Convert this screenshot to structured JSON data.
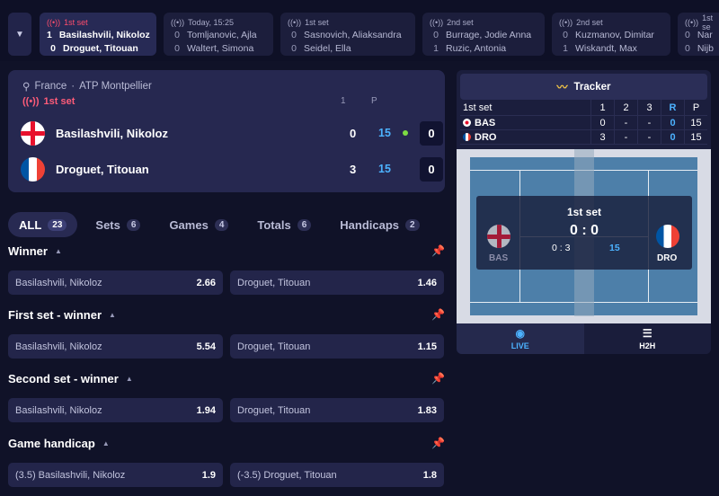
{
  "strip": {
    "matches": [
      {
        "status": "1st set",
        "active": true,
        "p1": {
          "score": "1",
          "name": "Basilashvili, Nikoloz"
        },
        "p2": {
          "score": "0",
          "name": "Droguet, Titouan"
        }
      },
      {
        "status": "Today, 15:25",
        "active": false,
        "p1": {
          "score": "0",
          "name": "Tomljanovic, Ajla"
        },
        "p2": {
          "score": "0",
          "name": "Waltert, Simona"
        }
      },
      {
        "status": "1st set",
        "active": false,
        "p1": {
          "score": "0",
          "name": "Sasnovich, Aliaksandra"
        },
        "p2": {
          "score": "0",
          "name": "Seidel, Ella"
        }
      },
      {
        "status": "2nd set",
        "active": false,
        "p1": {
          "score": "0",
          "name": "Burrage, Jodie Anna"
        },
        "p2": {
          "score": "1",
          "name": "Ruzic, Antonia"
        }
      },
      {
        "status": "2nd set",
        "active": false,
        "p1": {
          "score": "0",
          "name": "Kuzmanov, Dimitar"
        },
        "p2": {
          "score": "1",
          "name": "Wiskandt, Max"
        }
      },
      {
        "status": "1st se",
        "active": false,
        "p1": {
          "score": "0",
          "name": "Nar"
        },
        "p2": {
          "score": "0",
          "name": "Nijb"
        }
      }
    ]
  },
  "match": {
    "country": "France",
    "separator": "·",
    "tournament": "ATP Montpellier",
    "status": "1st set",
    "col_sets": "1",
    "col_points": "P",
    "players": [
      {
        "name": "Basilashvili, Nikoloz",
        "sets": "0",
        "points": "15",
        "games": "0",
        "serving": true
      },
      {
        "name": "Droguet, Titouan",
        "sets": "3",
        "points": "15",
        "games": "0",
        "serving": false
      }
    ]
  },
  "tabs": [
    {
      "label": "ALL",
      "count": "23",
      "active": true
    },
    {
      "label": "Sets",
      "count": "6",
      "active": false
    },
    {
      "label": "Games",
      "count": "4",
      "active": false
    },
    {
      "label": "Totals",
      "count": "6",
      "active": false
    },
    {
      "label": "Handicaps",
      "count": "2",
      "active": false
    }
  ],
  "markets": [
    {
      "title": "Winner",
      "left": {
        "name": "Basilashvili, Nikoloz",
        "odd": "2.66"
      },
      "right": {
        "name": "Droguet, Titouan",
        "odd": "1.46"
      }
    },
    {
      "title": "First set - winner",
      "left": {
        "name": "Basilashvili, Nikoloz",
        "odd": "5.54"
      },
      "right": {
        "name": "Droguet, Titouan",
        "odd": "1.15"
      }
    },
    {
      "title": "Second set - winner",
      "left": {
        "name": "Basilashvili, Nikoloz",
        "odd": "1.94"
      },
      "right": {
        "name": "Droguet, Titouan",
        "odd": "1.83"
      }
    },
    {
      "title": "Game handicap",
      "left": {
        "name": "(3.5) Basilashvili, Nikoloz",
        "odd": "1.9"
      },
      "right": {
        "name": "(-3.5) Droguet, Titouan",
        "odd": "1.8"
      }
    }
  ],
  "tracker": {
    "title": "Tracker",
    "scoreboard": {
      "set_label": "1st set",
      "columns": [
        "1",
        "2",
        "3",
        "R",
        "P"
      ],
      "rows": [
        {
          "abbr": "BAS",
          "values": [
            "0",
            "-",
            "-",
            "0",
            "15"
          ]
        },
        {
          "abbr": "DRO",
          "values": [
            "3",
            "-",
            "-",
            "0",
            "15"
          ]
        }
      ]
    },
    "overlay": {
      "set": "1st set",
      "games": "0 : 0",
      "sets": "0 : 3",
      "points": "15",
      "p1_abbr": "BAS",
      "p2_abbr": "DRO"
    },
    "tabs": {
      "live": "LIVE",
      "h2h": "H2H"
    }
  },
  "colors": {
    "accent_blue": "#4cb2ff",
    "live_red": "#ff4d6d",
    "serve_green": "#7ddc42",
    "tracker_yellow": "#f7c846"
  },
  "icons": [
    "chevron-down-icon",
    "broadcast-icon",
    "tennis-racket-icon",
    "pin-icon",
    "tracker-icon",
    "eye-icon",
    "h2h-icon",
    "caret-up-icon"
  ]
}
